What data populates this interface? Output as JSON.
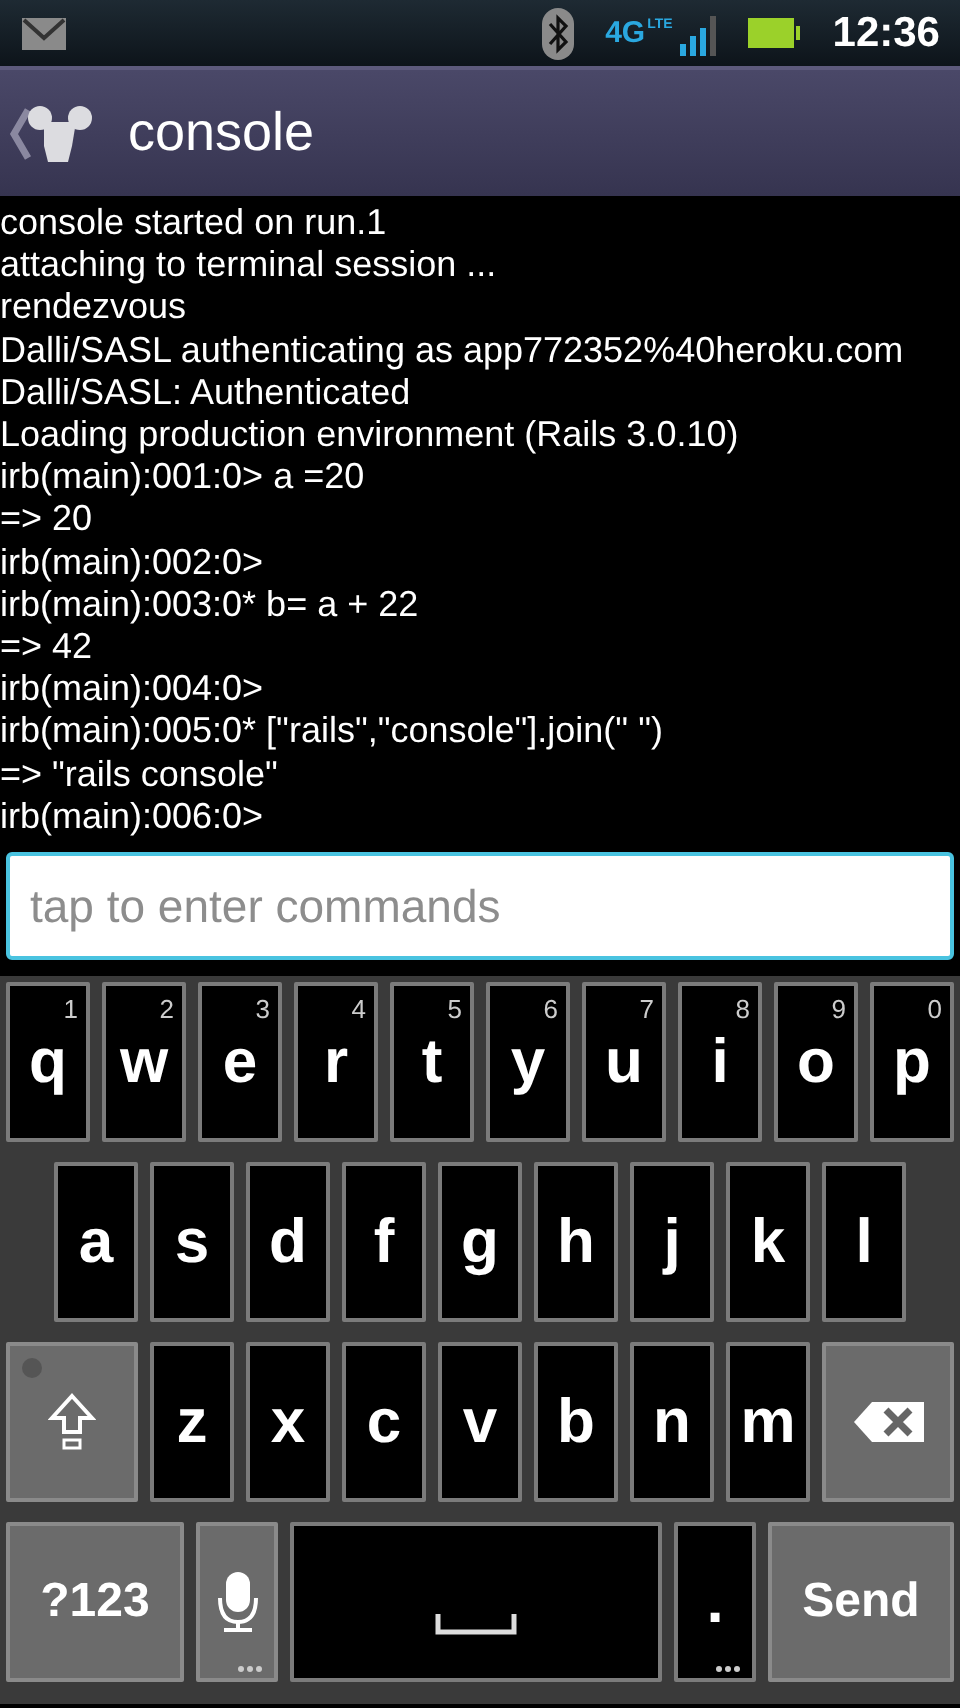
{
  "status_bar": {
    "network": "4G",
    "network_sub": "LTE",
    "time": "12:36"
  },
  "title": "console",
  "console_lines": [
    "console started on run.1",
    "attaching to terminal session ...",
    "rendezvous",
    "Dalli/SASL authenticating as app772352%40heroku.com",
    "Dalli/SASL: Authenticated",
    "Loading production environment (Rails 3.0.10)",
    "irb(main):001:0> a =20",
    "=> 20",
    "irb(main):002:0>",
    "irb(main):003:0* b= a + 22",
    "=> 42",
    "irb(main):004:0>",
    "irb(main):005:0* [\"rails\",\"console\"].join(\" \")",
    "=> \"rails console\"",
    "irb(main):006:0>"
  ],
  "command_field": {
    "placeholder": "tap to enter commands"
  },
  "keyboard": [
    [
      {
        "kind": "letter",
        "label": "q",
        "hint": "1"
      },
      {
        "kind": "letter",
        "label": "w",
        "hint": "2"
      },
      {
        "kind": "letter",
        "label": "e",
        "hint": "3"
      },
      {
        "kind": "letter",
        "label": "r",
        "hint": "4"
      },
      {
        "kind": "letter",
        "label": "t",
        "hint": "5"
      },
      {
        "kind": "letter",
        "label": "y",
        "hint": "6"
      },
      {
        "kind": "letter",
        "label": "u",
        "hint": "7"
      },
      {
        "kind": "letter",
        "label": "i",
        "hint": "8"
      },
      {
        "kind": "letter",
        "label": "o",
        "hint": "9"
      },
      {
        "kind": "letter",
        "label": "p",
        "hint": "0"
      }
    ],
    [
      {
        "kind": "letter",
        "label": "a"
      },
      {
        "kind": "letter",
        "label": "s"
      },
      {
        "kind": "letter",
        "label": "d"
      },
      {
        "kind": "letter",
        "label": "f"
      },
      {
        "kind": "letter",
        "label": "g"
      },
      {
        "kind": "letter",
        "label": "h"
      },
      {
        "kind": "letter",
        "label": "j"
      },
      {
        "kind": "letter",
        "label": "k"
      },
      {
        "kind": "letter",
        "label": "l"
      }
    ],
    [
      {
        "kind": "shift"
      },
      {
        "kind": "letter",
        "label": "z"
      },
      {
        "kind": "letter",
        "label": "x"
      },
      {
        "kind": "letter",
        "label": "c"
      },
      {
        "kind": "letter",
        "label": "v"
      },
      {
        "kind": "letter",
        "label": "b"
      },
      {
        "kind": "letter",
        "label": "n"
      },
      {
        "kind": "letter",
        "label": "m"
      },
      {
        "kind": "backspace"
      }
    ],
    [
      {
        "kind": "function",
        "label": "?123"
      },
      {
        "kind": "mic",
        "more": true
      },
      {
        "kind": "space"
      },
      {
        "kind": "letter",
        "label": ".",
        "more": true
      },
      {
        "kind": "function",
        "label": "Send"
      }
    ]
  ]
}
